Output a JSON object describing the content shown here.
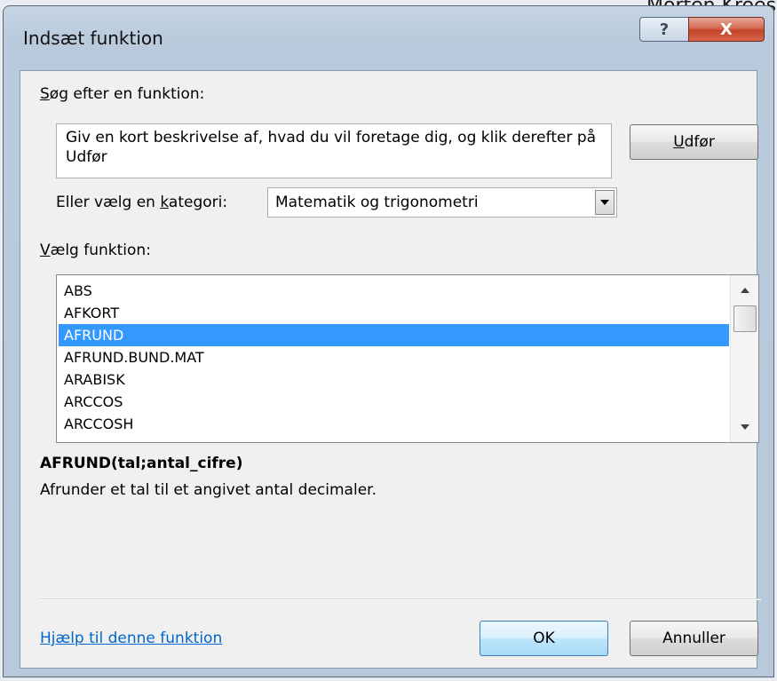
{
  "background": {
    "partial_text": "Morten Kroes"
  },
  "window": {
    "title": "Indsæt funktion",
    "help_glyph": "?",
    "close_glyph": "X"
  },
  "search": {
    "label_prefix": "",
    "label_mnemonic": "S",
    "label_rest": "øg efter en funktion:",
    "value": "Giv en kort beskrivelse af, hvad du vil foretage dig, og klik derefter på Udfør",
    "execute_mnemonic": "U",
    "execute_rest": "dfør"
  },
  "category": {
    "label_prefix": "Eller vælg en ",
    "label_mnemonic": "k",
    "label_rest": "ategori:",
    "selected": "Matematik og trigonometri"
  },
  "function_list": {
    "label_mnemonic": "V",
    "label_rest": "ælg funktion:",
    "items": [
      "ABS",
      "AFKORT",
      "AFRUND",
      "AFRUND.BUND.MAT",
      "ARABISK",
      "ARCCOS",
      "ARCCOSH"
    ],
    "selected_index": 2
  },
  "details": {
    "signature": "AFRUND(tal;antal_cifre)",
    "description": "Afrunder et tal til et angivet antal decimaler."
  },
  "footer": {
    "help_link": "Hjælp til denne funktion",
    "ok_label": "OK",
    "cancel_label": "Annuller"
  },
  "icons": {
    "dropdown": "chevron-down-icon",
    "scroll_up": "triangle-up-icon",
    "scroll_down": "triangle-down-icon"
  },
  "colors": {
    "selection": "#3399ff",
    "link": "#0066cc",
    "close_button": "#c4432a"
  }
}
